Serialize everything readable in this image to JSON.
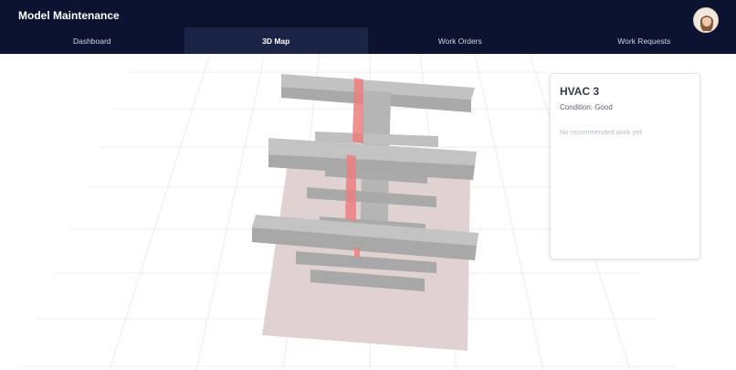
{
  "app": {
    "title": "Model Maintenance"
  },
  "nav": {
    "tabs": [
      {
        "label": "Dashboard",
        "active": false
      },
      {
        "label": "3D Map",
        "active": true
      },
      {
        "label": "Work Orders",
        "active": false
      },
      {
        "label": "Work Requests",
        "active": false
      }
    ]
  },
  "user": {
    "avatar_icon": "user-avatar"
  },
  "asset_panel": {
    "name": "HVAC 3",
    "condition": "Condition: Good",
    "recommendations_empty": "No recommended work yet."
  },
  "scene": {
    "grid_color": "#e6e6e6",
    "floor_color": "#d9c9c8",
    "structure_color": "#b8b8b8",
    "highlight_color": "#ee8080"
  }
}
